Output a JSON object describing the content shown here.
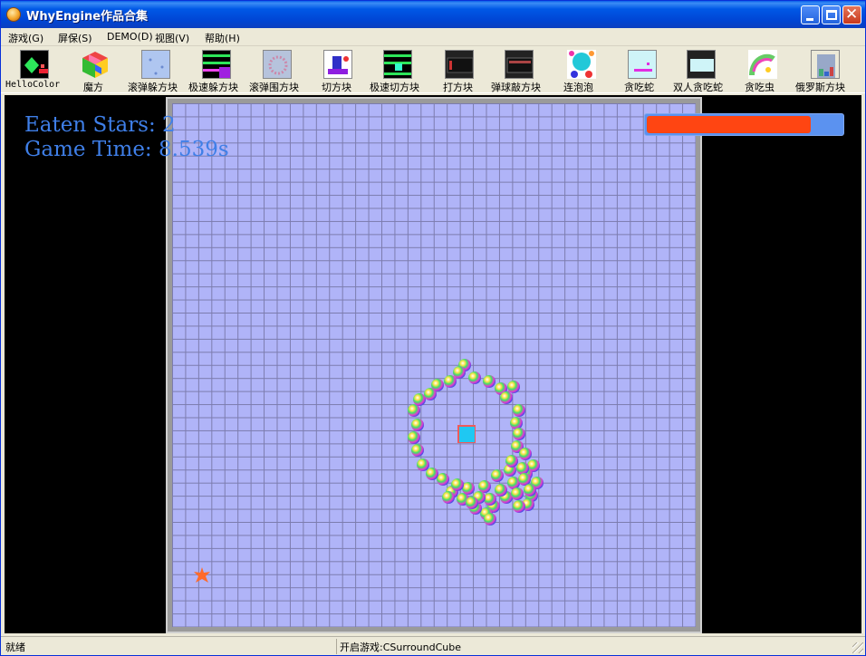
{
  "window": {
    "title": "WhyEngine作品合集"
  },
  "menu": [
    "游戏(G)",
    "屏保(S)",
    "DEMO(D)",
    "视图(V)",
    "帮助(H)"
  ],
  "toolbar": [
    {
      "label": "HelloColor",
      "icon": "hellocolor-icon"
    },
    {
      "label": "魔方",
      "icon": "rubiks-cube-icon"
    },
    {
      "label": "滚弹躲方块",
      "icon": "roll-dodge-icon"
    },
    {
      "label": "极速躲方块",
      "icon": "speed-dodge-icon"
    },
    {
      "label": "滚弹围方块",
      "icon": "roll-surround-icon"
    },
    {
      "label": "切方块",
      "icon": "cut-cube-icon"
    },
    {
      "label": "极速切方块",
      "icon": "speed-cut-icon"
    },
    {
      "label": "打方块",
      "icon": "hit-cube-icon"
    },
    {
      "label": "弹球敲方块",
      "icon": "pinball-cube-icon"
    },
    {
      "label": "连泡泡",
      "icon": "bubbles-icon"
    },
    {
      "label": "贪吃蛇",
      "icon": "snake-icon"
    },
    {
      "label": "双人贪吃蛇",
      "icon": "two-player-snake-icon"
    },
    {
      "label": "贪吃虫",
      "icon": "worm-icon"
    },
    {
      "label": "俄罗斯方块",
      "icon": "tetris-icon"
    }
  ],
  "hud": {
    "eaten_stars": "Eaten Stars: 2",
    "game_time": "Game Time: 8.539s"
  },
  "health": {
    "fraction": 0.84
  },
  "status": {
    "left": "就绪",
    "right": "开启游戏:CSurroundCube"
  },
  "colors": {
    "hud_text": "#3F7FE8",
    "board": "#B0B4F8",
    "health_fill": "#FF4512",
    "health_bg": "#5B92F0",
    "player_cube": "#1FC8F2",
    "star": "#FF6A2A"
  }
}
